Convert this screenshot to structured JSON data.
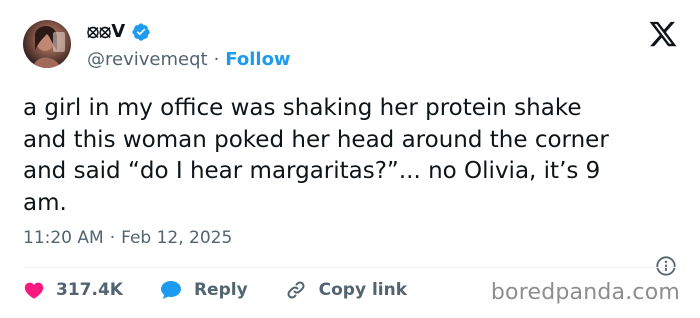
{
  "author": {
    "display_name": "⦻⦻V",
    "handle": "@revivemeqt",
    "separator": "·",
    "follow_label": "Follow"
  },
  "tweet": {
    "text": "a girl in my office was shaking her protein shake\nand this woman poked her head around the corner\nand said “do I hear margaritas?”... no Olivia, it’s 9\nam."
  },
  "meta": {
    "time": "11:20 AM",
    "separator": "·",
    "date": "Feb 12, 2025"
  },
  "actions": {
    "likes": "317.4K",
    "reply_label": "Reply",
    "copy_link_label": "Copy link"
  },
  "watermark": "boredpanda.com",
  "colors": {
    "accent": "#1d9bf0",
    "like": "#f91880",
    "secondary_text": "#536471"
  }
}
